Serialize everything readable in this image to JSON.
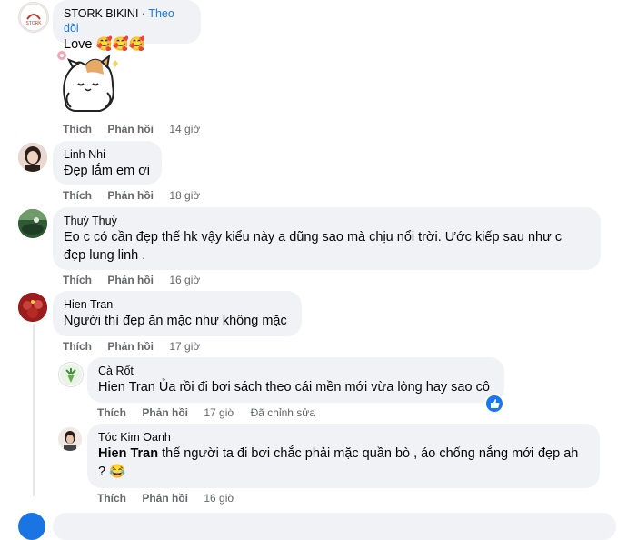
{
  "comments": [
    {
      "author": "STORK BIKINI",
      "follow": "Theo dõi",
      "text": "Love 🥰🥰🥰",
      "like": "Thích",
      "reply": "Phản hồi",
      "time": "14 giờ"
    },
    {
      "author": "Linh Nhi",
      "text": "Đẹp lắm em ơi",
      "like": "Thích",
      "reply": "Phản hồi",
      "time": "18 giờ"
    },
    {
      "author": "Thuỳ Thuỳ",
      "text_line1": "Eo c có cần đẹp thế hk vậy kiểu này a dũng sao mà chịu nổi trời. Ước kiếp sau như c",
      "text_line2": "đẹp lung linh .",
      "like": "Thích",
      "reply": "Phản hồi",
      "time": "16 giờ"
    },
    {
      "author": "Hien Tran",
      "text": "Người thì đẹp ăn mặc như không mặc",
      "like": "Thích",
      "reply": "Phản hồi",
      "time": "17 giờ"
    }
  ],
  "replies": [
    {
      "author": "Cà Rốt",
      "text": "Hien Tran Ủa rồi đi bơi sách theo cái mền mới vừa lòng hay sao cô",
      "like": "Thích",
      "reply": "Phản hồi",
      "time": "17 giờ",
      "edited": "Đã chỉnh sửa"
    },
    {
      "author": "Tóc Kim Oanh",
      "mention": "Hien Tran",
      "text_line1": " thế người ta đi bơi chắc phải mặc quần bò , áo chống nắng mới đẹp ah",
      "text_line2": "? 😂",
      "like": "Thích",
      "reply": "Phản hồi",
      "time": "16 giờ"
    }
  ],
  "icons": {
    "like_reaction": "like-icon",
    "sticker": "cat-sticker"
  },
  "colors": {
    "bubble": "#f0f2f5",
    "link": "#1877f2",
    "meta": "#65676b"
  }
}
